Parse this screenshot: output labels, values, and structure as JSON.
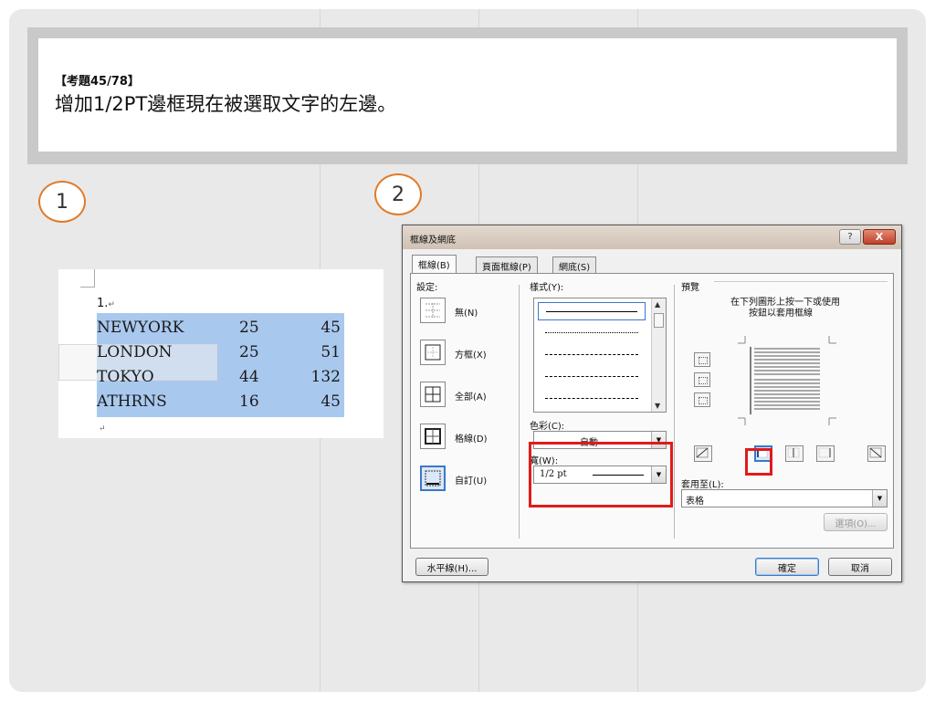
{
  "slide": {
    "question_number": "【考題45/78】",
    "question_text": "增加1/2PT邊框現在被選取文字的左邊。",
    "step1": "1",
    "step2": "2"
  },
  "document": {
    "list_number": "1.",
    "end_mark": "↵",
    "rows": [
      {
        "c1": "NEWYORK",
        "c2": "25",
        "c3": "45"
      },
      {
        "c1": "LONDON",
        "c2": "25",
        "c3": "51"
      },
      {
        "c1": "TOKYO",
        "c2": "44",
        "c3": "132"
      },
      {
        "c1": "ATHRNS",
        "c2": "16",
        "c3": "45"
      }
    ]
  },
  "dialog": {
    "title": "框線及網底",
    "help": "?",
    "close": "X",
    "tabs": [
      "框線(B)",
      "頁面框線(P)",
      "網底(S)"
    ],
    "settings_label": "設定:",
    "settings": [
      "無(N)",
      "方框(X)",
      "全部(A)",
      "格線(D)",
      "自訂(U)"
    ],
    "style_label": "樣式(Y):",
    "color_label": "色彩(C):",
    "color_value": "自動",
    "width_label": "寬(W):",
    "width_value": "1/2 pt",
    "preview_label": "預覽",
    "preview_hint_1": "在下列圖形上按一下或使用",
    "preview_hint_2": "按鈕以套用框線",
    "apply_label": "套用至(L):",
    "apply_value": "表格",
    "options_button": "選項(O)...",
    "hline_button": "水平線(H)...",
    "ok_button": "確定",
    "cancel_button": "取消"
  },
  "colors": {
    "highlight": "#e01b1b",
    "selection": "#a9c8ee",
    "circle": "#e07b2a"
  }
}
